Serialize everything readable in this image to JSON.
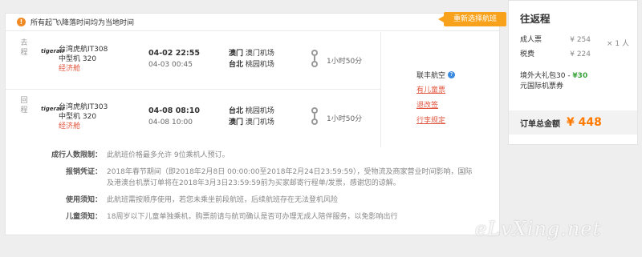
{
  "notice": "所有起飞\\降落时间均为当地时间",
  "rebook_label": "重新选择航班",
  "segments": [
    {
      "label": "去程",
      "logo": "tigerair",
      "airline": "台湾虎航IT308",
      "aircraft": "中型机 320",
      "cabin": "经济舱",
      "dep_time": "04-02 22:55",
      "arr_time": "04-03 00:45",
      "dep_city": "澳门",
      "dep_airport": "澳门机场",
      "arr_city": "台北",
      "arr_airport": "桃园机场",
      "duration": "1小时50分"
    },
    {
      "label": "回程",
      "logo": "tigerair",
      "airline": "台湾虎航IT303",
      "aircraft": "中型机 320",
      "cabin": "经济舱",
      "dep_time": "04-08 08:10",
      "arr_time": "04-08 10:00",
      "dep_city": "台北",
      "dep_airport": "桃园机场",
      "arr_city": "澳门",
      "arr_airport": "澳门机场",
      "duration": "1小时50分"
    }
  ],
  "side": {
    "carrier": "联丰航空",
    "links": [
      "有儿童票",
      "退改签",
      "行李规定"
    ]
  },
  "rules": [
    {
      "key": "成行人数限制：",
      "value": "此航班价格最多允许 9位乘机人预订。"
    },
    {
      "key": "报销凭证：",
      "value": "2018年春节期间（即2018年2月8日 00:00:00至2018年2月24日23:59:59），受物流及商家营业时间影响，国际及港澳台机票订单将在2018年3月3日23:59:59前为买家邮寄行程单/发票，感谢您的谅解。"
    },
    {
      "key": "使用须知：",
      "value": "此航班需按顺序使用，若您未乘坐前段航班，后续航班存在无法登机风险"
    },
    {
      "key": "儿童须知：",
      "value": "18周岁以下儿童单独乘机，购票前请与航司确认是否可办理无成人陪伴服务，以免影响出行"
    }
  ],
  "summary": {
    "title": "往返程",
    "adult_label": "成人票",
    "adult_price": "¥ 254",
    "tax_label": "税费",
    "tax_price": "¥ 224",
    "multiplier": "× 1 人",
    "coupon_line1_a": "境外大礼包30 - ",
    "coupon_amount": "¥30",
    "coupon_line2": "元国际机票券",
    "total_label": "订单总金额",
    "total_amount": "¥ 448"
  },
  "watermark": "eLvXing.net",
  "colors": {
    "accent_orange": "#f7a21a",
    "price_orange": "#ff7a00",
    "link_red": "#e0553d",
    "discount_green": "#3aa33a"
  }
}
